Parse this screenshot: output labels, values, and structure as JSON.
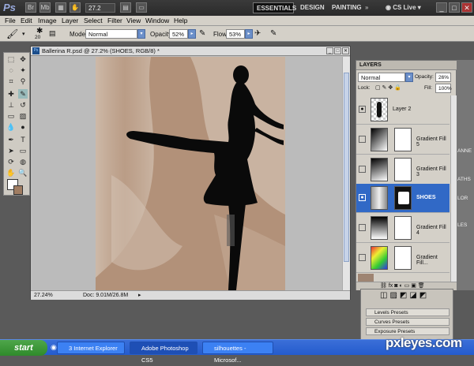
{
  "titlebar": {
    "logo": "Ps",
    "zoom": "27.2",
    "essentials": "ESSENTIALS",
    "design": "DESIGN",
    "painting": "PAINTING",
    "more": "»",
    "cslive": "CS Live"
  },
  "menu": [
    "File",
    "Edit",
    "Image",
    "Layer",
    "Select",
    "Filter",
    "View",
    "Window",
    "Help"
  ],
  "options": {
    "brush_size": "20",
    "mode_label": "Mode:",
    "mode": "Normal",
    "opacity_label": "Opacity:",
    "opacity": "52%",
    "flow_label": "Flow:",
    "flow": "53%"
  },
  "document": {
    "title": "Ballerina R.psd @ 27.2% (SHOES, RGB/8) *",
    "zoom": "27.24%",
    "doc_info": "Doc: 9.01M/26.8M"
  },
  "layers_panel": {
    "tab": "LAYERS",
    "blend": "Normal",
    "opacity_label": "Opacity:",
    "opacity": "26%",
    "lock_label": "Lock:",
    "fill_label": "Fill:",
    "fill": "100%",
    "layers": [
      {
        "name": "Layer 2",
        "visible": true
      },
      {
        "name": "Gradient Fill 5",
        "visible": false
      },
      {
        "name": "Gradient Fill 3",
        "visible": false
      },
      {
        "name": "SHOES",
        "visible": true,
        "selected": true
      },
      {
        "name": "Gradient Fill 4",
        "visible": false
      },
      {
        "name": "Gradient Fill...",
        "visible": false
      }
    ]
  },
  "side_labels": [
    "ANNE",
    "ATHS",
    "LOR",
    "LES"
  ],
  "adjustments": [
    "Levels Presets",
    "Curves Presets",
    "Exposure Presets"
  ],
  "taskbar": {
    "start": "start",
    "tasks": [
      "3 Internet Explorer",
      "Adobe Photoshop CS5",
      "silhouettes - Microsof..."
    ]
  },
  "watermark": "pxleyes.com"
}
